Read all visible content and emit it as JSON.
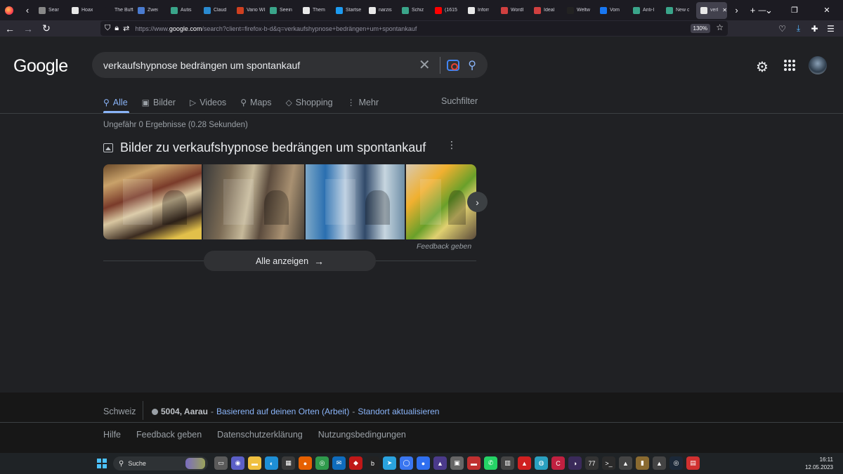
{
  "browser": {
    "tabs": [
      {
        "label": "Sear",
        "color": "#888888"
      },
      {
        "label": "Hoax",
        "color": "#e8e8e8"
      },
      {
        "label": "The Buffalo",
        "color": "#1c1b22"
      },
      {
        "label": "Zwei",
        "color": "#4a7bd0"
      },
      {
        "label": "Autis",
        "color": "#3aa58a"
      },
      {
        "label": "Claud",
        "color": "#2a8ad0"
      },
      {
        "label": "Vario WIEDER",
        "color": "#d04020"
      },
      {
        "label": "Seein",
        "color": "#3aa58a"
      },
      {
        "label": "Them",
        "color": "#e8e8e8"
      },
      {
        "label": "Startse",
        "color": "#1d9bf0"
      },
      {
        "label": "narzis",
        "color": "#e8e8e8"
      },
      {
        "label": "Schiz",
        "color": "#3aa58a"
      },
      {
        "label": "(1615",
        "color": "#ff0000"
      },
      {
        "label": "Inforr",
        "color": "#e8e8e8"
      },
      {
        "label": "Wordl",
        "color": "#d04040"
      },
      {
        "label": "Ideal",
        "color": "#d04040"
      },
      {
        "label": "Weltw",
        "color": "#222222"
      },
      {
        "label": "Vom",
        "color": "#1877f2"
      },
      {
        "label": "Anti-I",
        "color": "#3aa58a"
      },
      {
        "label": "New c",
        "color": "#3aa58a"
      },
      {
        "label": "verk",
        "color": "#e8e8e8"
      }
    ],
    "url_prefix": "https://www.",
    "url_domain": "google.com",
    "url_rest": "/search?client=firefox-b-d&q=verkaufshypnose+bedrängen+um+spontankauf",
    "zoom": "130%"
  },
  "google": {
    "logo": "Google",
    "query": "verkaufshypnose bedrängen um spontankauf",
    "tabs": [
      {
        "label": "Alle",
        "icon": "search-icon"
      },
      {
        "label": "Bilder",
        "icon": "image-icon"
      },
      {
        "label": "Videos",
        "icon": "video-icon"
      },
      {
        "label": "Maps",
        "icon": "map-pin-icon"
      },
      {
        "label": "Shopping",
        "icon": "tag-icon"
      },
      {
        "label": "Mehr",
        "icon": "more-vert-icon"
      }
    ],
    "suchfilter": "Suchfilter",
    "stats": "Ungefähr 0 Ergebnisse (0.28 Sekunden)",
    "images_title": "Bilder zu verkaufshypnose bedrängen um spontankauf",
    "feedback": "Feedback geben",
    "show_all": "Alle anzeigen"
  },
  "footer": {
    "country": "Schweiz",
    "location": "5004, Aarau",
    "sep": "-",
    "based_on": "Basierend auf deinen Orten (Arbeit)",
    "sep2": "-",
    "update": "Standort aktualisieren",
    "links": [
      "Hilfe",
      "Feedback geben",
      "Datenschutzerklärung",
      "Nutzungsbedingungen"
    ]
  },
  "taskbar": {
    "search_label": "Suche",
    "time": "16:11",
    "date": "12.05.2023",
    "icons": [
      {
        "name": "task-view-icon",
        "color": "#5a5a5a",
        "glyph": "▭"
      },
      {
        "name": "chat-icon",
        "color": "#5b5fc7",
        "glyph": "◉"
      },
      {
        "name": "file-explorer-icon",
        "color": "#f0c040",
        "glyph": "▬"
      },
      {
        "name": "edge-icon",
        "color": "#1e8fd6",
        "glyph": "◐"
      },
      {
        "name": "store-icon",
        "color": "#3a3a3a",
        "glyph": "▦"
      },
      {
        "name": "firefox-icon",
        "color": "#e66000",
        "glyph": "●"
      },
      {
        "name": "chrome-icon",
        "color": "#2f9a4c",
        "glyph": "◎"
      },
      {
        "name": "mail-icon",
        "color": "#0f6cbd",
        "glyph": "✉"
      },
      {
        "name": "app-red-icon",
        "color": "#c01818",
        "glyph": "◆"
      },
      {
        "name": "bing-icon",
        "color": "#222222",
        "glyph": "b"
      },
      {
        "name": "telegram-icon",
        "color": "#2aa3df",
        "glyph": "➤"
      },
      {
        "name": "signal-icon",
        "color": "#3a76f0",
        "glyph": "◯"
      },
      {
        "name": "messenger-icon",
        "color": "#2f6ff0",
        "glyph": "●"
      },
      {
        "name": "app-purple-icon",
        "color": "#4b3a8a",
        "glyph": "▲"
      },
      {
        "name": "app-box-icon",
        "color": "#666666",
        "glyph": "▣"
      },
      {
        "name": "app-banner-icon",
        "color": "#c03030",
        "glyph": "▬"
      },
      {
        "name": "whatsapp-icon",
        "color": "#25d366",
        "glyph": "✆"
      },
      {
        "name": "books-icon",
        "color": "#444444",
        "glyph": "▥"
      },
      {
        "name": "app-triangle-icon",
        "color": "#d02020",
        "glyph": "▲"
      },
      {
        "name": "app-cyan-icon",
        "color": "#2aa0c0",
        "glyph": "◍"
      },
      {
        "name": "app-c-icon",
        "color": "#c02040",
        "glyph": "C"
      },
      {
        "name": "app-dark-icon",
        "color": "#3a2a5a",
        "glyph": "◑"
      },
      {
        "name": "app-77-icon",
        "color": "#333333",
        "glyph": "77"
      },
      {
        "name": "terminal-icon",
        "color": "#2b2b2b",
        "glyph": ">_"
      },
      {
        "name": "linux-icon",
        "color": "#444444",
        "glyph": "▲"
      },
      {
        "name": "app-doc-icon",
        "color": "#8a6a30",
        "glyph": "▮"
      },
      {
        "name": "linux2-icon",
        "color": "#444444",
        "glyph": "▲"
      },
      {
        "name": "steam-icon",
        "color": "#1b2838",
        "glyph": "◎"
      },
      {
        "name": "app-last-icon",
        "color": "#d03030",
        "glyph": "▤"
      }
    ]
  }
}
